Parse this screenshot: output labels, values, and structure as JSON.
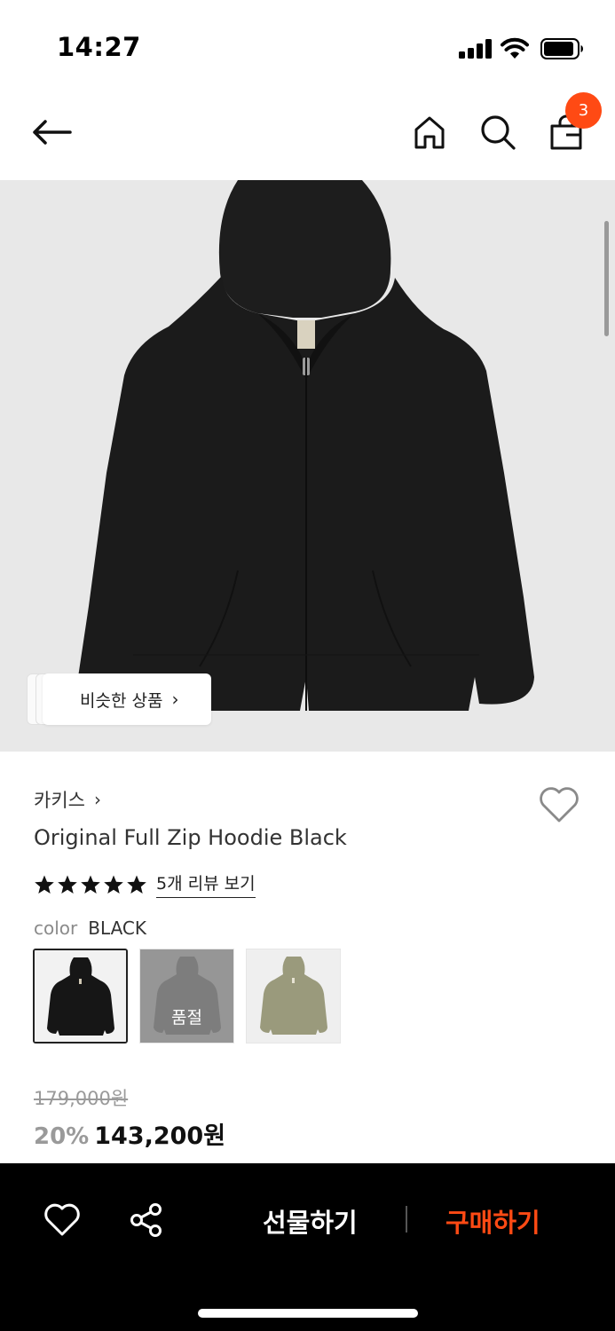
{
  "status_bar": {
    "time": "14:27"
  },
  "nav": {
    "back_icon": "arrow-left-icon",
    "home_icon": "home-icon",
    "search_icon": "search-icon",
    "cart_icon": "shopping-bag-icon",
    "cart_count": "3"
  },
  "product_image": {
    "similar_label": "비슷한 상품",
    "similar_chevron": "›"
  },
  "product": {
    "brand": "카키스",
    "brand_chevron": "›",
    "name": "Original Full Zip Hoodie Black",
    "rating_stars": 5,
    "review_link": "5개 리뷰 보기",
    "color_label": "color",
    "color_value": "BLACK",
    "swatches": [
      {
        "color": "black",
        "selected": true,
        "sold_out": false
      },
      {
        "color": "gray",
        "selected": false,
        "sold_out": true,
        "sold_out_label": "품절"
      },
      {
        "color": "khaki",
        "selected": false,
        "sold_out": false
      }
    ],
    "original_price": "179,000원",
    "discount": "20%",
    "price": "143,200원"
  },
  "bottom_bar": {
    "wish_icon": "heart-icon",
    "share_icon": "share-icon",
    "gift_label": "선물하기",
    "buy_label": "구매하기"
  },
  "colors": {
    "accent": "#ff4a14",
    "bottom_bar_bg": "#000000",
    "image_bg": "#e8e8e8"
  }
}
